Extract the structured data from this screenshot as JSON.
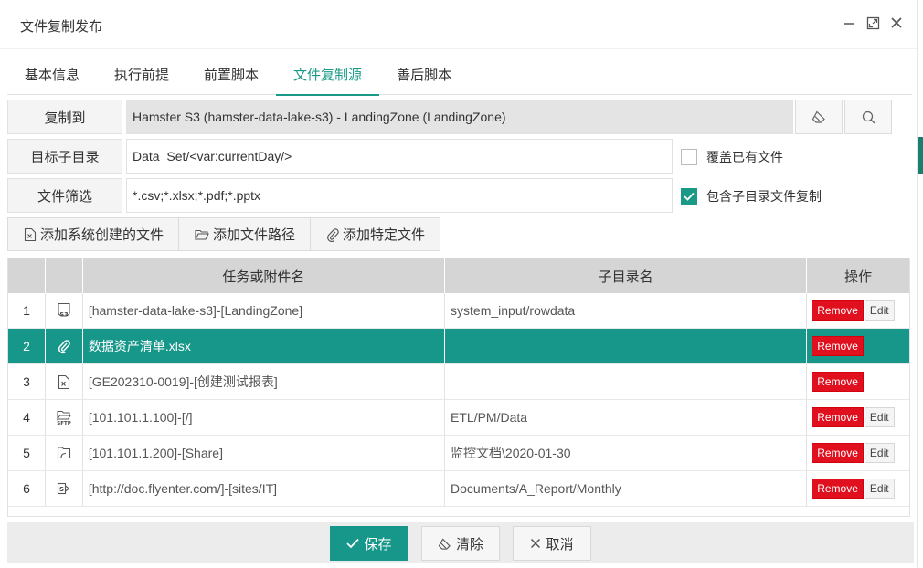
{
  "dialog": {
    "title": "文件复制发布"
  },
  "tabs": [
    {
      "label": "基本信息"
    },
    {
      "label": "执行前提"
    },
    {
      "label": "前置脚本"
    },
    {
      "label": "文件复制源",
      "active": true
    },
    {
      "label": "善后脚本"
    }
  ],
  "form": {
    "copy_to": {
      "label": "复制到",
      "value": "Hamster S3 (hamster-data-lake-s3) - LandingZone (LandingZone)"
    },
    "target_subdir": {
      "label": "目标子目录",
      "value": "Data_Set/<var:currentDay/>"
    },
    "file_filter": {
      "label": "文件筛选",
      "value": "*.csv;*.xlsx;*.pdf;*.pptx"
    },
    "overwrite": {
      "label": "覆盖已有文件",
      "checked": false
    },
    "include_subdirs": {
      "label": "包含子目录文件复制",
      "checked": true
    }
  },
  "add_buttons": {
    "system_file": "添加系统创建的文件",
    "file_path": "添加文件路径",
    "specific_file": "添加特定文件"
  },
  "grid": {
    "columns": {
      "name": "任务或附件名",
      "subdir": "子目录名",
      "ops": "操作"
    },
    "rows": [
      {
        "no": "1",
        "icon": "s3-icon",
        "name": "[hamster-data-lake-s3]-[LandingZone]",
        "subdir": "system_input/rowdata",
        "remove": "Remove",
        "edit": "Edit"
      },
      {
        "no": "2",
        "icon": "paperclip-icon",
        "name": "数据资产清单.xlsx",
        "subdir": "",
        "remove": "Remove",
        "edit": ""
      },
      {
        "no": "3",
        "icon": "excel-file-icon",
        "name": "[GE202310-0019]-[创建测试报表]",
        "subdir": "",
        "remove": "Remove",
        "edit": ""
      },
      {
        "no": "4",
        "icon": "sftp-folder-icon",
        "name": "[101.101.1.100]-[/]",
        "subdir": "ETL/PM/Data",
        "remove": "Remove",
        "edit": "Edit"
      },
      {
        "no": "5",
        "icon": "share-folder-icon",
        "name": "[101.101.1.200]-[Share]",
        "subdir": "监控文档\\2020-01-30",
        "remove": "Remove",
        "edit": "Edit"
      },
      {
        "no": "6",
        "icon": "sharepoint-icon",
        "name": "[http://doc.flyenter.com/]-[sites/IT]",
        "subdir": "Documents/A_Report/Monthly",
        "remove": "Remove",
        "edit": "Edit"
      }
    ],
    "selected_row": "2"
  },
  "footer": {
    "save": "保存",
    "clear": "清除",
    "cancel": "取消"
  },
  "colors": {
    "accent": "#17978a",
    "danger": "#e0101e"
  }
}
